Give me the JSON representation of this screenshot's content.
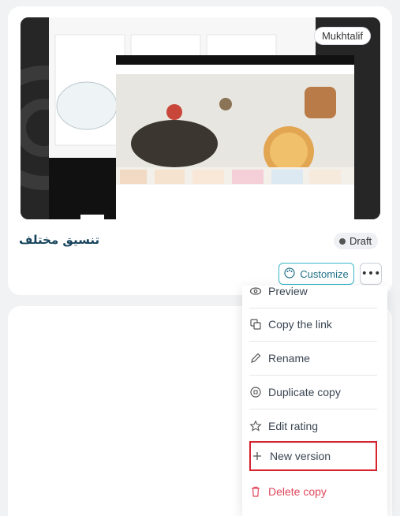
{
  "card": {
    "theme_badge": "Mukhtalif",
    "title": "تنسيق مختلف",
    "status": "Draft",
    "customize_label": "Customize",
    "more_icon": "more-horizontal-icon"
  },
  "menu": {
    "items": [
      {
        "label": "Preview",
        "icon": "eye-icon"
      },
      {
        "label": "Copy the link",
        "icon": "copy-icon"
      },
      {
        "label": "Rename",
        "icon": "pencil-icon"
      },
      {
        "label": "Duplicate copy",
        "icon": "duplicate-icon"
      },
      {
        "label": "Edit rating",
        "icon": "star-icon"
      },
      {
        "label": "New version",
        "icon": "plus-icon"
      },
      {
        "label": "Delete copy",
        "icon": "trash-icon"
      }
    ]
  },
  "colors": {
    "accent": "#39b7c7",
    "title": "#17445c",
    "danger": "#e0475b",
    "highlight": "#d8232f"
  }
}
